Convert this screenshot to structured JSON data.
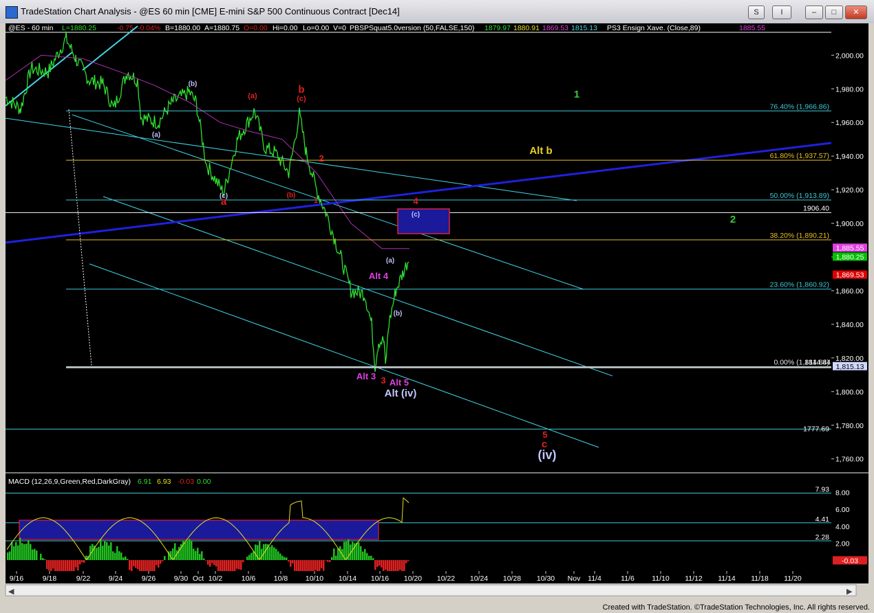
{
  "window": {
    "title": "TradeStation Chart Analysis - @ES 60 min [CME] E-mini S&P 500 Continuous Contract [Dec14]",
    "buttons": [
      "S",
      "I",
      "–",
      "□",
      "✕"
    ]
  },
  "header": {
    "symbol": "@ES - 60 min",
    "cme": "CME",
    "last": "L=1880.25",
    "chg": "-0.75",
    "pct": "-0.04%",
    "bid": "B=1880.00",
    "ask": "A=1880.75",
    "open": "O=0.00",
    "hi": "Hi=0.00",
    "lo": "Lo=0.00",
    "vol": "V=0",
    "study": "PBSPSquat5.0version (50,FALSE,150)",
    "s1": "1879.97",
    "s2": "1880.91",
    "s3": "1869.53",
    "s4": "1815.13",
    "study2": "PS3 Ensign Xave. (Close,89)",
    "s5": "1885.55"
  },
  "price_axis": [
    "2,000.00",
    "1,980.00",
    "1,960.00",
    "1,940.00",
    "1,920.00",
    "1,900.00",
    "1,880.00",
    "1,860.00",
    "1,840.00",
    "1,820.00",
    "1,800.00",
    "1,780.00",
    "1,760.00"
  ],
  "date_axis": [
    "9/16",
    "9/18",
    "9/22",
    "9/24",
    "9/26",
    "9/30",
    "Oct",
    "10/2",
    "10/6",
    "10/8",
    "10/10",
    "10/14",
    "10/16",
    "10/20",
    "10/22",
    "10/24",
    "10/28",
    "10/30",
    "Nov",
    "11/4",
    "11/6",
    "11/10",
    "11/12",
    "11/14",
    "11/18",
    "11/20"
  ],
  "fib_levels": [
    {
      "label": "76.40% (1,966.86)",
      "value": 1966.86
    },
    {
      "label": "61.80% (1,937.57)",
      "value": 1937.57
    },
    {
      "label": "50.00% (1,913.89)",
      "value": 1913.89
    },
    {
      "label": "38.20% (1,890.21)",
      "value": 1890.21
    },
    {
      "label": "23.60% (1,860.92)",
      "value": 1860.92
    },
    {
      "label": "0.00% (1,814.84)",
      "value": 1814.84
    }
  ],
  "horizontal_levels": [
    {
      "label": "1906.40",
      "value": 1906.4
    },
    {
      "label": "1777.69",
      "value": 1777.69
    },
    {
      "label": "1814.84",
      "value": 1814.84
    }
  ],
  "right_tags": [
    {
      "label": "1,885.55",
      "color": "#e040e0",
      "value": 1885.55
    },
    {
      "label": "1,880.25",
      "color": "#00c000",
      "value": 1880.25
    },
    {
      "label": "1,869.53",
      "color": "#e00000",
      "value": 1869.53
    },
    {
      "label": "1,815.13",
      "color": "#cfd8ff",
      "value": 1815.13
    }
  ],
  "wave_labels": [
    {
      "text": "1",
      "color": "#3ac83a"
    },
    {
      "text": "2",
      "color": "#3ac83a"
    },
    {
      "text": "Alt b",
      "color": "#e8d020"
    },
    {
      "text": "b",
      "color": "#e02020"
    },
    {
      "text": "(c)",
      "color": "#e02020"
    },
    {
      "text": "(a)",
      "color": "#e02020"
    },
    {
      "text": "a",
      "color": "#e02020"
    },
    {
      "text": "(c)",
      "color": "#c0c0ff"
    },
    {
      "text": "(b)",
      "color": "#c0c0ff"
    },
    {
      "text": "(a)",
      "color": "#c0c0ff"
    },
    {
      "text": "(b)",
      "color": "#e02020"
    },
    {
      "text": "1",
      "color": "#e02020"
    },
    {
      "text": "2",
      "color": "#e02020"
    },
    {
      "text": "4",
      "color": "#e02020"
    },
    {
      "text": "(c)",
      "color": "#c0c0ff"
    },
    {
      "text": "(a)",
      "color": "#c0c0ff"
    },
    {
      "text": "(b)",
      "color": "#c0c0ff"
    },
    {
      "text": "Alt 4",
      "color": "#e040e0"
    },
    {
      "text": "Alt 3",
      "color": "#e040e0"
    },
    {
      "text": "3",
      "color": "#e02020"
    },
    {
      "text": "Alt 5",
      "color": "#e040e0"
    },
    {
      "text": "Alt (iv)",
      "color": "#c0c8ff"
    },
    {
      "text": "5",
      "color": "#e02020"
    },
    {
      "text": "c",
      "color": "#e02020"
    },
    {
      "text": "(iv)",
      "color": "#c0c8ff"
    }
  ],
  "macd": {
    "label": "MACD (12,26,9,Green,Red,DarkGray)",
    "v1": "6.91",
    "v2": "6.93",
    "v3": "-0.03",
    "v4": "0.00",
    "axis": [
      "8.00",
      "6.00",
      "4.00",
      "2.00"
    ],
    "levels": [
      "7.93",
      "4.41",
      "2.28"
    ],
    "tag": "-0.03"
  },
  "footer": "Created with TradeStation. ©TradeStation Technologies, Inc. All rights reserved.",
  "chart_data": {
    "type": "line",
    "title": "@ES 60 min [CME] E-mini S&P 500 Continuous Contract [Dec14]",
    "x": [
      "9/16",
      "9/18",
      "9/22",
      "9/24",
      "9/26",
      "9/30",
      "10/2",
      "10/6",
      "10/8",
      "10/10",
      "10/14",
      "10/16",
      "10/20"
    ],
    "series": [
      {
        "name": "@ES - 60 min",
        "values": [
          1975,
          2008,
          1985,
          1975,
          1962,
          1972,
          1925,
          1965,
          1950,
          1905,
          1862,
          1815,
          1880
        ]
      },
      {
        "name": "PS3 Ensign Xave. (Close,89)",
        "values": [
          1985,
          2000,
          1998,
          1990,
          1982,
          1972,
          1960,
          1955,
          1950,
          1930,
          1900,
          1885,
          1885
        ]
      }
    ],
    "ylim": [
      1752,
      2012
    ],
    "colors": {
      "price": "#30e030",
      "average": "#b030b0",
      "channel": "#40d8e8",
      "trend": "#2020e0",
      "background": "#000000"
    }
  }
}
